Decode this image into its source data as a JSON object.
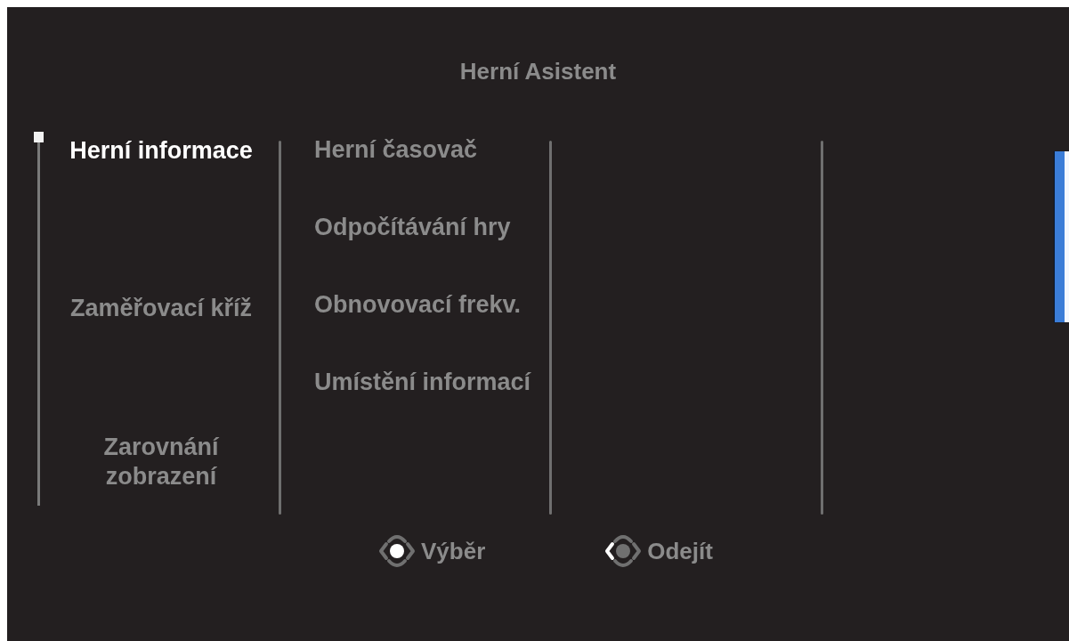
{
  "title": "Herní Asistent",
  "categories": [
    {
      "label": "Herní informace",
      "selected": true
    },
    {
      "label": "Zaměřovací kříž",
      "selected": false
    },
    {
      "label": "Zarovnání zobrazení",
      "selected": false
    }
  ],
  "options": [
    {
      "label": "Herní časovač"
    },
    {
      "label": "Odpočítávání hry"
    },
    {
      "label": "Obnovovací frekv."
    },
    {
      "label": "Umístění informací"
    }
  ],
  "hints": [
    {
      "kind": "center",
      "label": "Výběr"
    },
    {
      "kind": "left",
      "label": "Odejít"
    }
  ]
}
